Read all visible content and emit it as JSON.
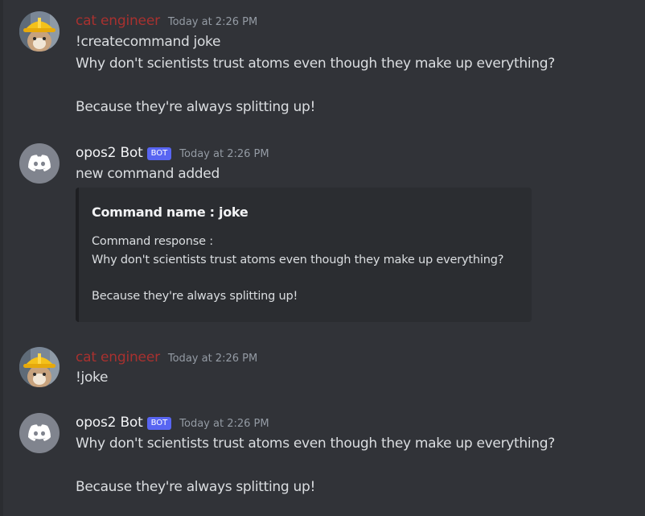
{
  "colors": {
    "background": "#313338",
    "user_name": "#a8312f",
    "bot_name": "#f2f3f5",
    "bot_badge": "#5865f2",
    "timestamp": "#949ba4",
    "embed_bg": "#2b2d31"
  },
  "messages": [
    {
      "author": "cat engineer",
      "avatar_icon": "cat-hardhat-avatar",
      "timestamp": "Today at 2:26 PM",
      "lines": [
        "!createcommand joke",
        "Why don't scientists trust atoms even though they make up everything?",
        "",
        "Because they're always splitting up!"
      ]
    },
    {
      "author": "opos2 Bot",
      "badge": "BOT",
      "avatar_icon": "discord-logo-icon",
      "timestamp": "Today at 2:26 PM",
      "lines": [
        "new command added"
      ],
      "embed": {
        "title": "Command name : joke",
        "description_lines": [
          "Command response :",
          "Why don't scientists trust atoms even though they make up everything?",
          "",
          "Because they're always splitting up!"
        ]
      }
    },
    {
      "author": "cat engineer",
      "avatar_icon": "cat-hardhat-avatar",
      "timestamp": "Today at 2:26 PM",
      "lines": [
        "!joke"
      ]
    },
    {
      "author": "opos2 Bot",
      "badge": "BOT",
      "avatar_icon": "discord-logo-icon",
      "timestamp": "Today at 2:26 PM",
      "lines": [
        "Why don't scientists trust atoms even though they make up everything?",
        "",
        "Because they're always splitting up!"
      ]
    }
  ]
}
